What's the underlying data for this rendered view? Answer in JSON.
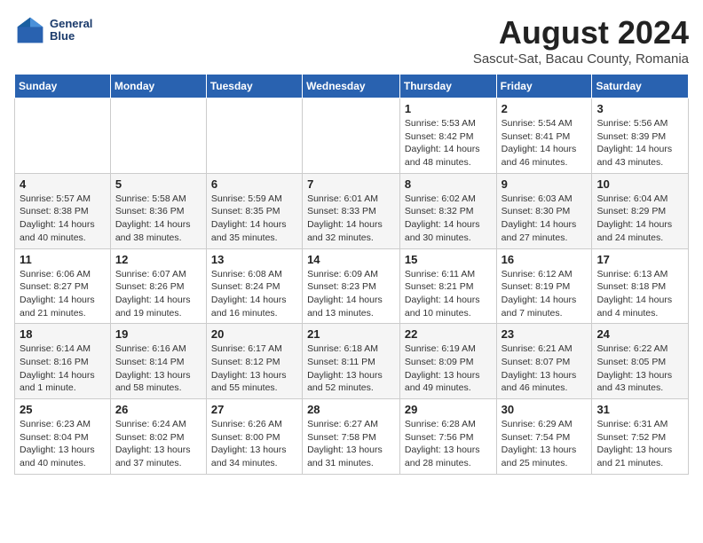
{
  "logo": {
    "line1": "General",
    "line2": "Blue"
  },
  "title": "August 2024",
  "subtitle": "Sascut-Sat, Bacau County, Romania",
  "days_of_week": [
    "Sunday",
    "Monday",
    "Tuesday",
    "Wednesday",
    "Thursday",
    "Friday",
    "Saturday"
  ],
  "weeks": [
    [
      {
        "day": "",
        "info": ""
      },
      {
        "day": "",
        "info": ""
      },
      {
        "day": "",
        "info": ""
      },
      {
        "day": "",
        "info": ""
      },
      {
        "day": "1",
        "info": "Sunrise: 5:53 AM\nSunset: 8:42 PM\nDaylight: 14 hours and 48 minutes."
      },
      {
        "day": "2",
        "info": "Sunrise: 5:54 AM\nSunset: 8:41 PM\nDaylight: 14 hours and 46 minutes."
      },
      {
        "day": "3",
        "info": "Sunrise: 5:56 AM\nSunset: 8:39 PM\nDaylight: 14 hours and 43 minutes."
      }
    ],
    [
      {
        "day": "4",
        "info": "Sunrise: 5:57 AM\nSunset: 8:38 PM\nDaylight: 14 hours and 40 minutes."
      },
      {
        "day": "5",
        "info": "Sunrise: 5:58 AM\nSunset: 8:36 PM\nDaylight: 14 hours and 38 minutes."
      },
      {
        "day": "6",
        "info": "Sunrise: 5:59 AM\nSunset: 8:35 PM\nDaylight: 14 hours and 35 minutes."
      },
      {
        "day": "7",
        "info": "Sunrise: 6:01 AM\nSunset: 8:33 PM\nDaylight: 14 hours and 32 minutes."
      },
      {
        "day": "8",
        "info": "Sunrise: 6:02 AM\nSunset: 8:32 PM\nDaylight: 14 hours and 30 minutes."
      },
      {
        "day": "9",
        "info": "Sunrise: 6:03 AM\nSunset: 8:30 PM\nDaylight: 14 hours and 27 minutes."
      },
      {
        "day": "10",
        "info": "Sunrise: 6:04 AM\nSunset: 8:29 PM\nDaylight: 14 hours and 24 minutes."
      }
    ],
    [
      {
        "day": "11",
        "info": "Sunrise: 6:06 AM\nSunset: 8:27 PM\nDaylight: 14 hours and 21 minutes."
      },
      {
        "day": "12",
        "info": "Sunrise: 6:07 AM\nSunset: 8:26 PM\nDaylight: 14 hours and 19 minutes."
      },
      {
        "day": "13",
        "info": "Sunrise: 6:08 AM\nSunset: 8:24 PM\nDaylight: 14 hours and 16 minutes."
      },
      {
        "day": "14",
        "info": "Sunrise: 6:09 AM\nSunset: 8:23 PM\nDaylight: 14 hours and 13 minutes."
      },
      {
        "day": "15",
        "info": "Sunrise: 6:11 AM\nSunset: 8:21 PM\nDaylight: 14 hours and 10 minutes."
      },
      {
        "day": "16",
        "info": "Sunrise: 6:12 AM\nSunset: 8:19 PM\nDaylight: 14 hours and 7 minutes."
      },
      {
        "day": "17",
        "info": "Sunrise: 6:13 AM\nSunset: 8:18 PM\nDaylight: 14 hours and 4 minutes."
      }
    ],
    [
      {
        "day": "18",
        "info": "Sunrise: 6:14 AM\nSunset: 8:16 PM\nDaylight: 14 hours and 1 minute."
      },
      {
        "day": "19",
        "info": "Sunrise: 6:16 AM\nSunset: 8:14 PM\nDaylight: 13 hours and 58 minutes."
      },
      {
        "day": "20",
        "info": "Sunrise: 6:17 AM\nSunset: 8:12 PM\nDaylight: 13 hours and 55 minutes."
      },
      {
        "day": "21",
        "info": "Sunrise: 6:18 AM\nSunset: 8:11 PM\nDaylight: 13 hours and 52 minutes."
      },
      {
        "day": "22",
        "info": "Sunrise: 6:19 AM\nSunset: 8:09 PM\nDaylight: 13 hours and 49 minutes."
      },
      {
        "day": "23",
        "info": "Sunrise: 6:21 AM\nSunset: 8:07 PM\nDaylight: 13 hours and 46 minutes."
      },
      {
        "day": "24",
        "info": "Sunrise: 6:22 AM\nSunset: 8:05 PM\nDaylight: 13 hours and 43 minutes."
      }
    ],
    [
      {
        "day": "25",
        "info": "Sunrise: 6:23 AM\nSunset: 8:04 PM\nDaylight: 13 hours and 40 minutes."
      },
      {
        "day": "26",
        "info": "Sunrise: 6:24 AM\nSunset: 8:02 PM\nDaylight: 13 hours and 37 minutes."
      },
      {
        "day": "27",
        "info": "Sunrise: 6:26 AM\nSunset: 8:00 PM\nDaylight: 13 hours and 34 minutes."
      },
      {
        "day": "28",
        "info": "Sunrise: 6:27 AM\nSunset: 7:58 PM\nDaylight: 13 hours and 31 minutes."
      },
      {
        "day": "29",
        "info": "Sunrise: 6:28 AM\nSunset: 7:56 PM\nDaylight: 13 hours and 28 minutes."
      },
      {
        "day": "30",
        "info": "Sunrise: 6:29 AM\nSunset: 7:54 PM\nDaylight: 13 hours and 25 minutes."
      },
      {
        "day": "31",
        "info": "Sunrise: 6:31 AM\nSunset: 7:52 PM\nDaylight: 13 hours and 21 minutes."
      }
    ]
  ]
}
